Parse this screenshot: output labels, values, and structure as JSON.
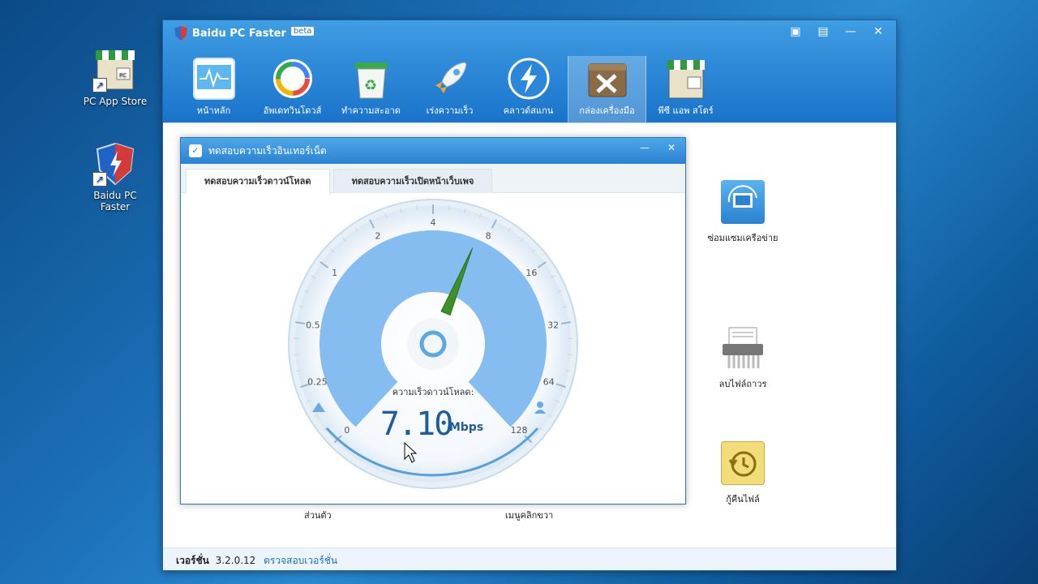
{
  "desktop": {
    "icons": [
      {
        "label": "PC App Store"
      },
      {
        "label": "Baidu PC Faster"
      }
    ]
  },
  "app": {
    "title": "Baidu PC Faster",
    "badge": "beta",
    "toolbar": [
      {
        "label": "หน้าหลัก",
        "icon": "monitor-pulse-icon"
      },
      {
        "label": "อัพเดทวินโดวส์",
        "icon": "update-ring-icon"
      },
      {
        "label": "ทำความสะอาด",
        "icon": "recycle-bin-icon"
      },
      {
        "label": "เร่งความเร็ว",
        "icon": "rocket-icon"
      },
      {
        "label": "คลาวด์สแกน",
        "icon": "lightning-icon"
      },
      {
        "label": "กล่องเครื่องมือ",
        "icon": "toolbox-icon"
      },
      {
        "label": "พีซี แอพ สโตร์",
        "icon": "store-icon"
      }
    ],
    "side_tools": [
      {
        "label": "ซ่อมแซมเครือข่าย"
      },
      {
        "label": "ลบไฟล์ถาวร"
      },
      {
        "label": "กู้คืนไฟล์"
      }
    ],
    "bottom_labels": [
      "ส่วนตัว",
      "เมนูคลิกขวา"
    ],
    "status": {
      "version_label": "เวอร์ชั่น",
      "version": "3.2.0.12",
      "check_link": "ตรวจสอบเวอร์ชั่น"
    }
  },
  "dialog": {
    "title": "ทดสอบความเร็วอินเทอร์เน็ต",
    "tabs": [
      "ทดสอบความเร็วดาวน์โหลด",
      "ทดสอบความเร็วเปิดหน้าเว็บเพจ"
    ],
    "gauge": {
      "ticks": [
        "0",
        "0.25",
        "0.5",
        "1",
        "2",
        "4",
        "8",
        "16",
        "32",
        "64",
        "128"
      ],
      "label": "ความเร็วดาวน์โหลด:",
      "value": "7.10",
      "unit": "Mbps",
      "needle_value": 7.1,
      "max": 128
    }
  }
}
